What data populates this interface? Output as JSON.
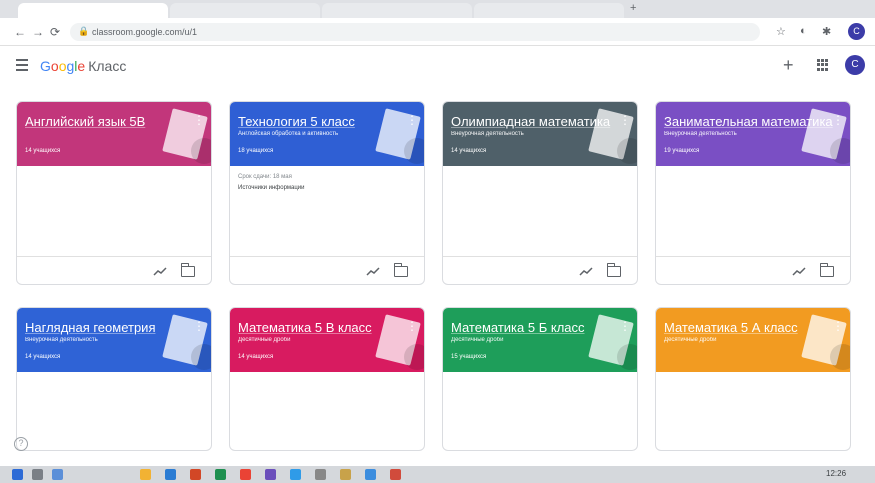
{
  "browser": {
    "url": "classroom.google.com/u/1",
    "new_tab": "+",
    "profile_initial": "С"
  },
  "app": {
    "brand_letters": [
      "G",
      "o",
      "o",
      "g",
      "l",
      "e"
    ],
    "product": "Класс",
    "add_label": "+",
    "user_initial": "С"
  },
  "colors": {
    "pink": "#c2367b",
    "blue": "#2f5fd4",
    "slate": "#4f6069",
    "purple": "#7a4fc4",
    "blue2": "#2f63d6",
    "crimson": "#d81b60",
    "green": "#1e9e5a",
    "orange": "#f29b21"
  },
  "cards": [
    {
      "title": "Английский язык 5В",
      "section": "",
      "students": "14 учащихся",
      "color": "pink",
      "note1": "",
      "note2": ""
    },
    {
      "title": "Технология 5 класс",
      "section": "Англойская обработка и активность",
      "students": "18 учащихся",
      "color": "blue",
      "note1": "Срок сдачи: 18 мая",
      "note2": "Источники информации"
    },
    {
      "title": "Олимпиадная математика",
      "section": "Внеурочная деятельность",
      "students": "14 учащихся",
      "color": "slate",
      "note1": "",
      "note2": ""
    },
    {
      "title": "Занимательная математика",
      "section": "Внеурочная деятельность",
      "students": "19 учащихся",
      "color": "purple",
      "note1": "",
      "note2": ""
    },
    {
      "title": "Наглядная геометрия",
      "section": "Внеурочная деятельность",
      "students": "14 учащихся",
      "color": "blue2",
      "note1": "",
      "note2": ""
    },
    {
      "title": "Математика 5 В класс",
      "section": "Десятичные дроби",
      "students": "14 учащихся",
      "color": "crimson",
      "note1": "",
      "note2": ""
    },
    {
      "title": "Математика 5 Б класс",
      "section": "Десятичные дроби",
      "students": "15 учащихся",
      "color": "green",
      "note1": "",
      "note2": ""
    },
    {
      "title": "Математика 5 А класс",
      "section": "Десятичные дроби",
      "students": "",
      "color": "orange",
      "note1": "",
      "note2": ""
    }
  ],
  "help": "?",
  "taskbar": {
    "time": "12:26"
  }
}
